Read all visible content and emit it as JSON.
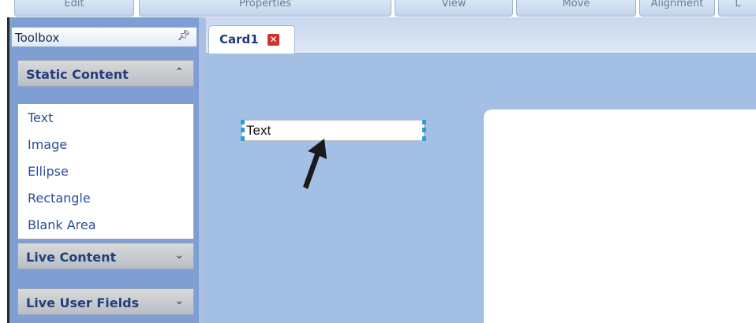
{
  "ribbon": {
    "tabs": [
      "Edit",
      "Properties",
      "View",
      "Move",
      "Alignment",
      "L"
    ]
  },
  "toolbox": {
    "title": "Toolbox",
    "pin_icon": "pin-icon",
    "sections": [
      {
        "label": "Static Content",
        "state": "expanded",
        "items": [
          "Text",
          "Image",
          "Ellipse",
          "Rectangle",
          "Blank Area"
        ]
      },
      {
        "label": "Live Content",
        "state": "collapsed"
      },
      {
        "label": "Live User Fields",
        "state": "collapsed"
      }
    ]
  },
  "document": {
    "tab_label": "Card1",
    "text_element_value": "Text"
  },
  "colors": {
    "canvas": "#a3bfe3",
    "toolbox_bg": "#7f9ed4",
    "section_label": "#233f7a",
    "item_text": "#2a4d9a",
    "close_icon": "#d0332b",
    "handle": "#2f9fcf"
  }
}
